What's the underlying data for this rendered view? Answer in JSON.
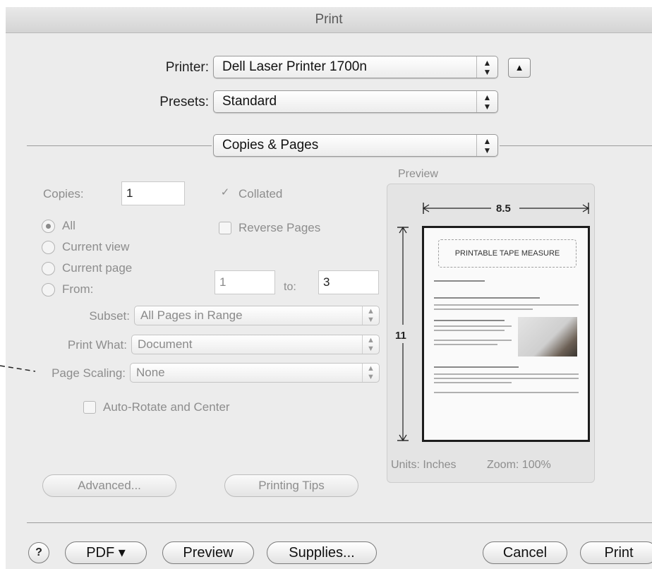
{
  "window": {
    "title": "Print"
  },
  "printer": {
    "label": "Printer:",
    "value": "Dell Laser Printer 1700n",
    "toggle_glyph": "▲"
  },
  "presets": {
    "label": "Presets:",
    "value": "Standard"
  },
  "panel": {
    "value": "Copies & Pages"
  },
  "copies": {
    "label": "Copies:",
    "value": "1",
    "collated_label": "Collated",
    "collated_checked": true,
    "reverse_label": "Reverse Pages",
    "reverse_checked": false
  },
  "pages": {
    "options": [
      "All",
      "Current view",
      "Current page",
      "From:"
    ],
    "selected": "All",
    "from_value": "1",
    "to_label": "to:",
    "to_value": "3"
  },
  "subset": {
    "label": "Subset:",
    "value": "All Pages in Range"
  },
  "print_what": {
    "label": "Print What:",
    "value": "Document"
  },
  "page_scaling": {
    "label": "Page Scaling:",
    "value": "None"
  },
  "auto_rotate": {
    "label": "Auto-Rotate and Center",
    "checked": false
  },
  "preview": {
    "label": "Preview",
    "width_label": "8.5",
    "height_label": "11",
    "page_title": "PRINTABLE TAPE MEASURE",
    "units": "Units: Inches",
    "zoom": "Zoom: 100%"
  },
  "buttons": {
    "advanced": "Advanced...",
    "printing_tips": "Printing Tips",
    "help": "?",
    "pdf": "PDF ▾",
    "preview": "Preview",
    "supplies": "Supplies...",
    "cancel": "Cancel",
    "print": "Print"
  },
  "icons": {
    "popup_arrows": "up-down-arrows-icon",
    "check": "checkmark-icon",
    "help": "question-icon"
  }
}
